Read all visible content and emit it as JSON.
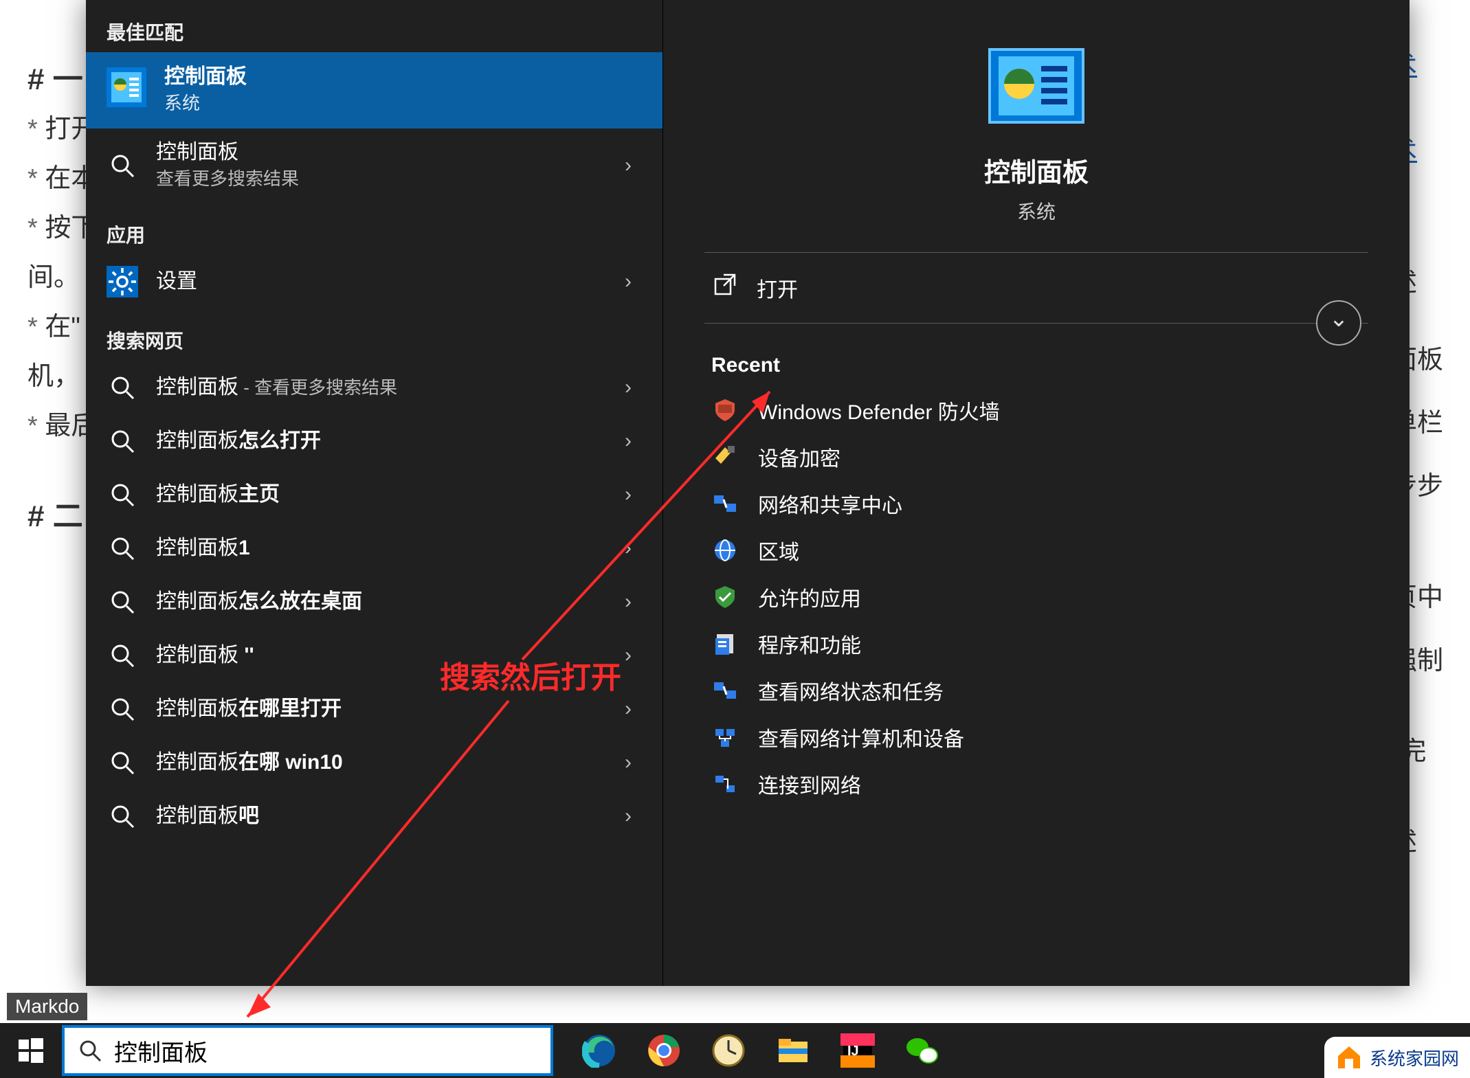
{
  "bg": {
    "h1a": "一",
    "lines": [
      "打开",
      "在本",
      "按下",
      "间。",
      "在\"",
      "机，",
      "最后"
    ],
    "h1b": "二",
    "right": [
      "术",
      "术",
      "述",
      "面板",
      "单栏",
      "步步",
      "页中",
      "强制",
      "\"完",
      "述"
    ]
  },
  "search": {
    "best_header": "最佳匹配",
    "best": {
      "title": "控制面板",
      "sub": "系统"
    },
    "more": {
      "title": "控制面板",
      "sub": "查看更多搜索结果"
    },
    "apps_header": "应用",
    "settings_label": "设置",
    "web_header": "搜索网页",
    "web": [
      {
        "pre": "控制面板",
        "suf": " - 查看更多搜索结果"
      },
      {
        "pre": "控制面板",
        "bold": "怎么打开"
      },
      {
        "pre": "控制面板",
        "bold": "主页"
      },
      {
        "pre": "控制面板",
        "bold": "1"
      },
      {
        "pre": "控制面板",
        "bold": "怎么放在桌面"
      },
      {
        "pre": "控制面板",
        "bold": " ''"
      },
      {
        "pre": "控制面板",
        "bold": "在哪里打开"
      },
      {
        "pre": "控制面板",
        "bold": "在哪 win10"
      },
      {
        "pre": "控制面板",
        "bold": "吧"
      }
    ]
  },
  "detail": {
    "title": "控制面板",
    "sub": "系统",
    "open": "打开",
    "recent_header": "Recent",
    "recent": [
      "Windows Defender 防火墙",
      "设备加密",
      "网络和共享中心",
      "区域",
      "允许的应用",
      "程序和功能",
      "查看网络状态和任务",
      "查看网络计算机和设备",
      "连接到网络"
    ]
  },
  "annotation": "搜索然后打开",
  "taskbar": {
    "markdo": "Markdo",
    "search_value": "控制面板"
  },
  "watermark": "系统家园网"
}
